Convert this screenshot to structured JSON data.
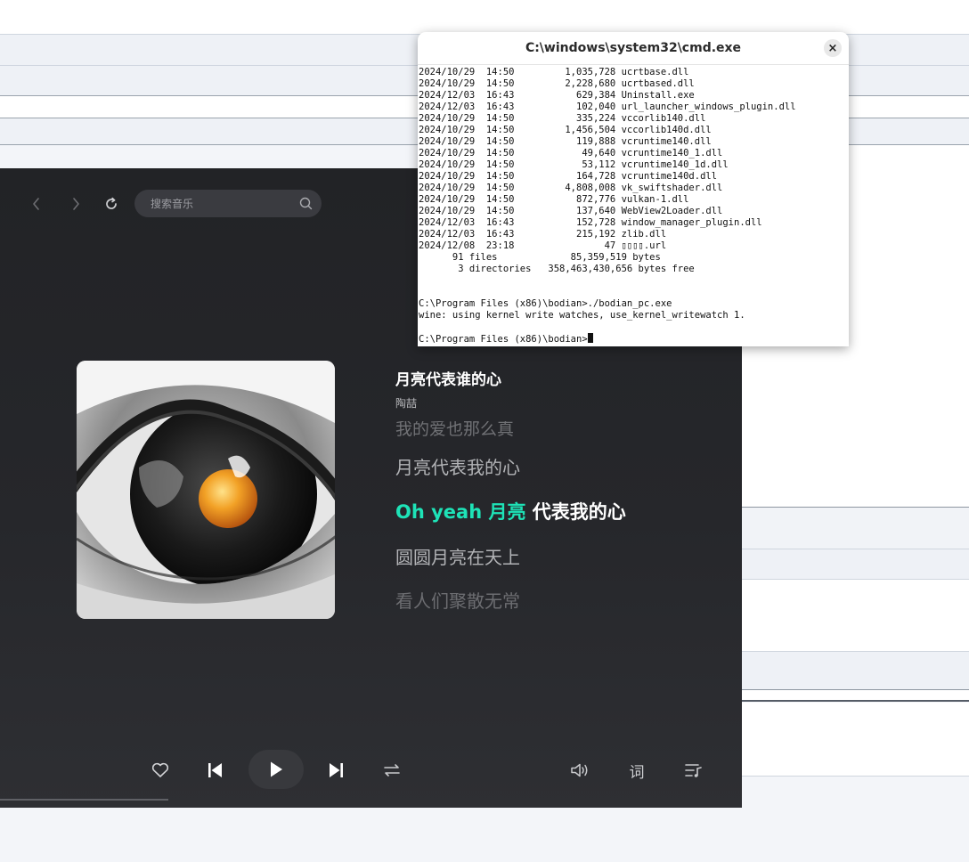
{
  "player": {
    "search_placeholder": "搜索音乐",
    "song": {
      "title": "月亮代表谁的心",
      "artist": "陶喆"
    },
    "lyrics": {
      "prev2": "我的爱也那么真",
      "prev1": "月亮代表我的心",
      "current_sung": "Oh yeah 月亮",
      "current_rest": " 代表我的心",
      "next1": "圆圆月亮在天上",
      "next2": "看人们聚散无常"
    },
    "lyrics_button_label": "词",
    "icons": {
      "back": "chevron-left-icon",
      "forward": "chevron-right-icon",
      "refresh": "refresh-icon",
      "search": "search-icon",
      "favorite": "heart-icon",
      "previous": "skip-previous-icon",
      "play": "play-icon",
      "next": "skip-next-icon",
      "mode": "repeat-mode-icon",
      "volume": "volume-icon",
      "playlist": "playlist-icon"
    },
    "accent_color": "#1ee3b7"
  },
  "cmd": {
    "title": "C:\\windows\\system32\\cmd.exe",
    "close_label": "×",
    "lines": [
      "2024/10/29  14:50         1,035,728 ucrtbase.dll",
      "2024/10/29  14:50         2,228,680 ucrtbased.dll",
      "2024/12/03  16:43           629,384 Uninstall.exe",
      "2024/12/03  16:43           102,040 url_launcher_windows_plugin.dll",
      "2024/10/29  14:50           335,224 vccorlib140.dll",
      "2024/10/29  14:50         1,456,504 vccorlib140d.dll",
      "2024/10/29  14:50           119,888 vcruntime140.dll",
      "2024/10/29  14:50            49,640 vcruntime140_1.dll",
      "2024/10/29  14:50            53,112 vcruntime140_1d.dll",
      "2024/10/29  14:50           164,728 vcruntime140d.dll",
      "2024/10/29  14:50         4,808,008 vk_swiftshader.dll",
      "2024/10/29  14:50           872,776 vulkan-1.dll",
      "2024/10/29  14:50           137,640 WebView2Loader.dll",
      "2024/12/03  16:43           152,728 window_manager_plugin.dll",
      "2024/12/03  16:43           215,192 zlib.dll",
      "2024/12/08  23:18                47 ▯▯▯▯.url",
      "      91 files             85,359,519 bytes",
      "       3 directories   358,463,430,656 bytes free",
      "",
      "",
      "C:\\Program Files (x86)\\bodian>./bodian_pc.exe",
      "wine: using kernel write watches, use_kernel_writewatch 1.",
      ""
    ],
    "prompt": "C:\\Program Files (x86)\\bodian>"
  }
}
